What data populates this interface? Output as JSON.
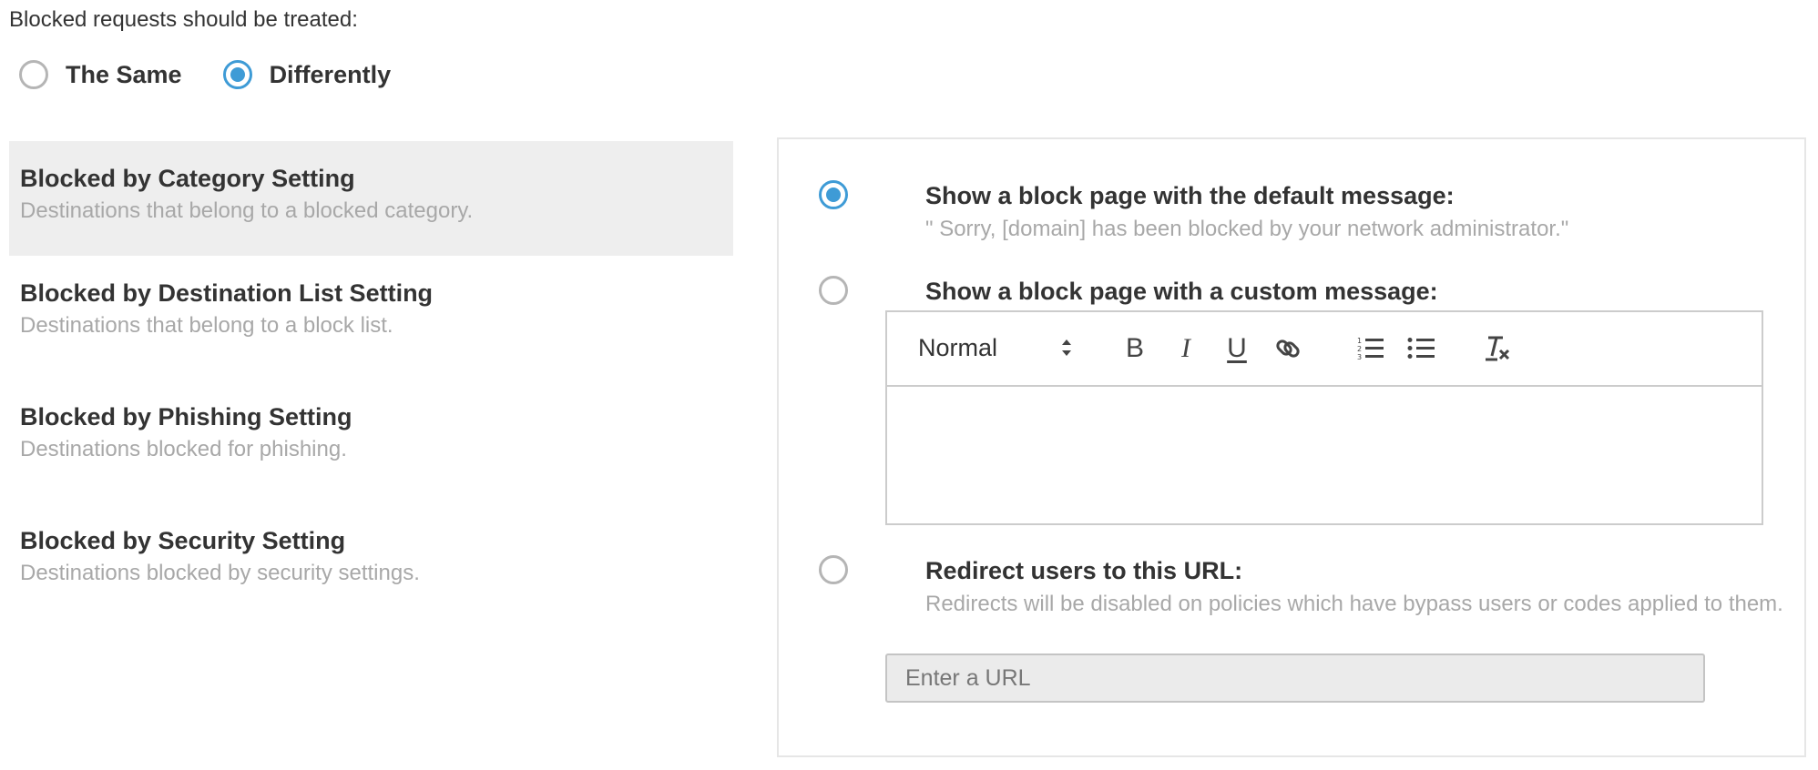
{
  "treatment": {
    "prompt": "Blocked requests should be treated:",
    "options": [
      {
        "label": "The Same",
        "checked": false
      },
      {
        "label": "Differently",
        "checked": true
      }
    ]
  },
  "categories": [
    {
      "title": "Blocked by Category Setting",
      "description": "Destinations that belong to a blocked category.",
      "active": true
    },
    {
      "title": "Blocked by Destination List Setting",
      "description": "Destinations that belong to a block list.",
      "active": false
    },
    {
      "title": "Blocked by Phishing Setting",
      "description": "Destinations blocked for phishing.",
      "active": false
    },
    {
      "title": "Blocked by Security Setting",
      "description": "Destinations blocked by security settings.",
      "active": false
    }
  ],
  "block_options": {
    "default": {
      "title": "Show a block page with the default message:",
      "message": "\" Sorry, [domain] has been blocked by your network administrator.\"",
      "checked": true
    },
    "custom": {
      "title": "Show a block page with a custom message:",
      "checked": false,
      "toolbar": {
        "format_value": "Normal",
        "bold_label": "B",
        "italic_label": "I",
        "underline_label": "U",
        "buttons": [
          "bold-icon",
          "italic-icon",
          "underline-icon",
          "link-icon",
          "ordered-list-icon",
          "bullet-list-icon",
          "clear-format-icon"
        ]
      },
      "body_text": ""
    },
    "redirect": {
      "title": "Redirect users to this URL:",
      "description": "Redirects will be disabled on policies which have bypass users or codes applied to them.",
      "placeholder": "Enter a URL",
      "value": "",
      "checked": false
    }
  },
  "colors": {
    "accent": "#3e9bd6",
    "active_bg": "#eeeeee",
    "muted_text": "#a8a8a8"
  }
}
